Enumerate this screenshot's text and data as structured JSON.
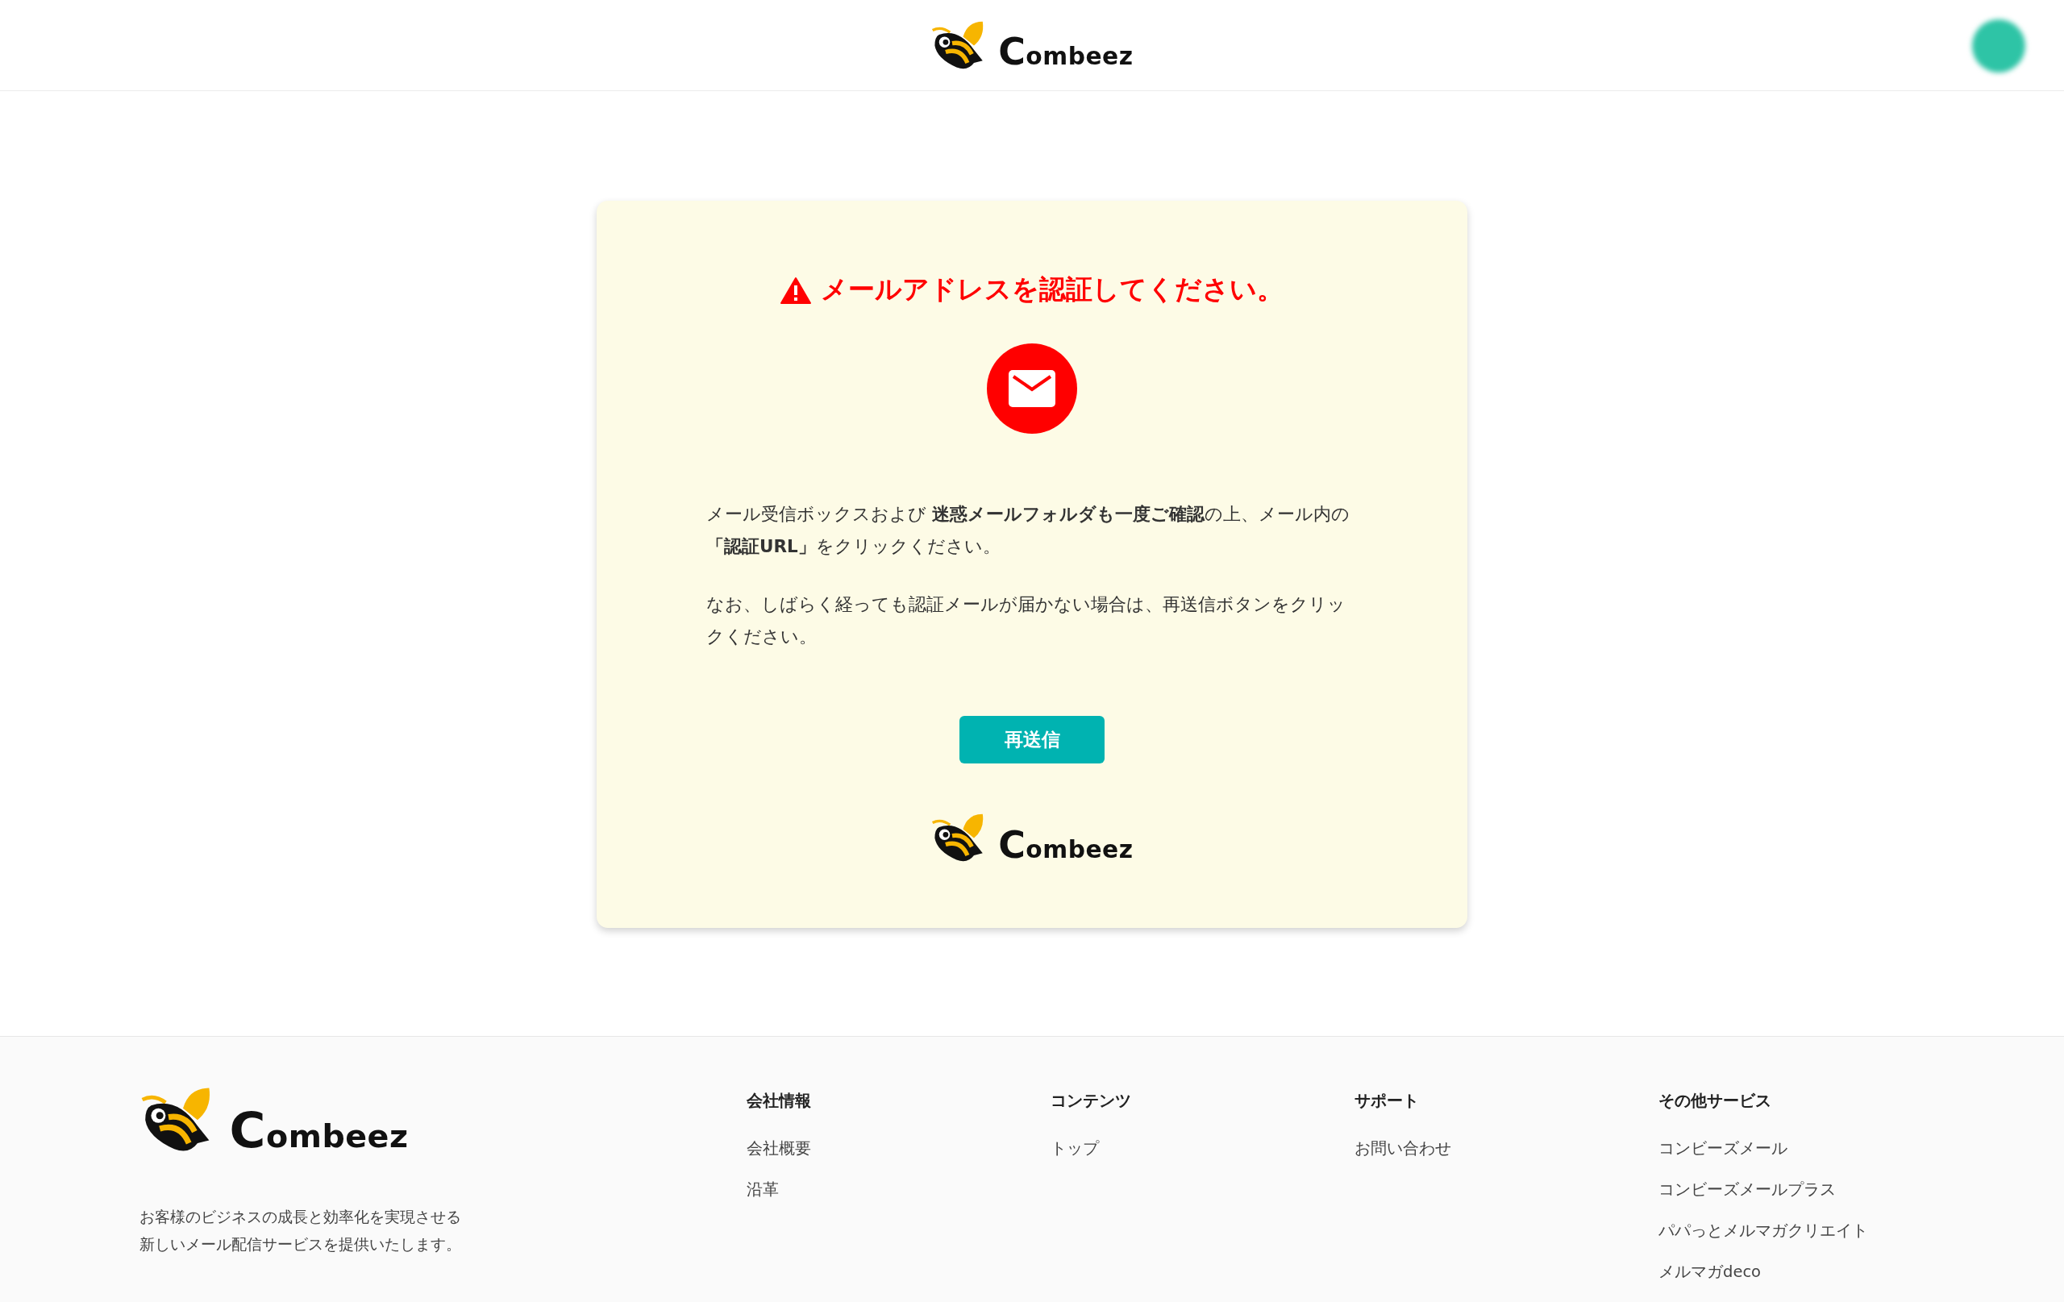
{
  "header": {
    "logo_text": "Combeez"
  },
  "card": {
    "title": "メールアドレスを認証してください。",
    "paragraphs": [
      "メール受信ボックスおよび **迷惑メールフォルダも一度ご確認**の上、メール内の**「認証URL」**をクリックください。",
      "なお、しばらく経っても認証メールが届かない場合は、再送信ボタンをクリックください。"
    ],
    "button": "再送信",
    "logo_text": "Combeez"
  },
  "footer": {
    "logo_text": "Combeez",
    "tagline": [
      "お客様のビジネスの成長と効率化を実現させる",
      "新しいメール配信サービスを提供いたします。"
    ],
    "columns": [
      {
        "heading": "会社情報",
        "links": [
          "会社概要",
          "沿革"
        ]
      },
      {
        "heading": "コンテンツ",
        "links": [
          "トップ"
        ]
      },
      {
        "heading": "サポート",
        "links": [
          "お問い合わせ"
        ]
      },
      {
        "heading": "その他サービス",
        "links": [
          "コンビーズメール",
          "コンビーズメールプラス",
          "パパっとメルマガクリエイト",
          "メルマガdeco"
        ]
      }
    ]
  }
}
